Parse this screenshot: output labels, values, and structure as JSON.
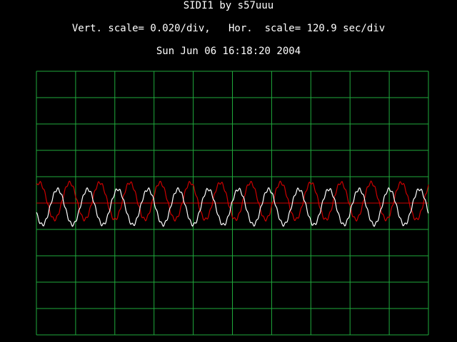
{
  "header": {
    "title": "SIDI1 by s57uuu",
    "scale_text": "Vert. scale= 0.020/div,   Hor.  scale= 120.9 sec/div",
    "timestamp": "Sun Jun 06 16:18:20 2004"
  },
  "plot": {
    "grid_divisions_x": 10,
    "grid_divisions_y": 10,
    "vertical_scale_per_div": 0.02,
    "horizontal_scale_sec_per_div": 120.9,
    "colors": {
      "background": "#000000",
      "grid": "#1faa3c",
      "trace_1": "#ffffff",
      "trace_2": "#cc0000",
      "baseline": "#cc0000"
    }
  },
  "chart_data": {
    "type": "line",
    "xlim": [
      0,
      1209
    ],
    "ylim": [
      -0.1,
      0.1
    ],
    "grid": true,
    "cycles_visible": 13,
    "series": [
      {
        "color": "#ffffff",
        "amplitude": 0.0135,
        "offset": -0.003,
        "cycles": 13,
        "phase": 0.55
      },
      {
        "color": "#cc0000",
        "amplitude": 0.014,
        "offset": 0.0015,
        "cycles": 13,
        "phase": 0.15
      }
    ],
    "baseline": 0.0
  }
}
